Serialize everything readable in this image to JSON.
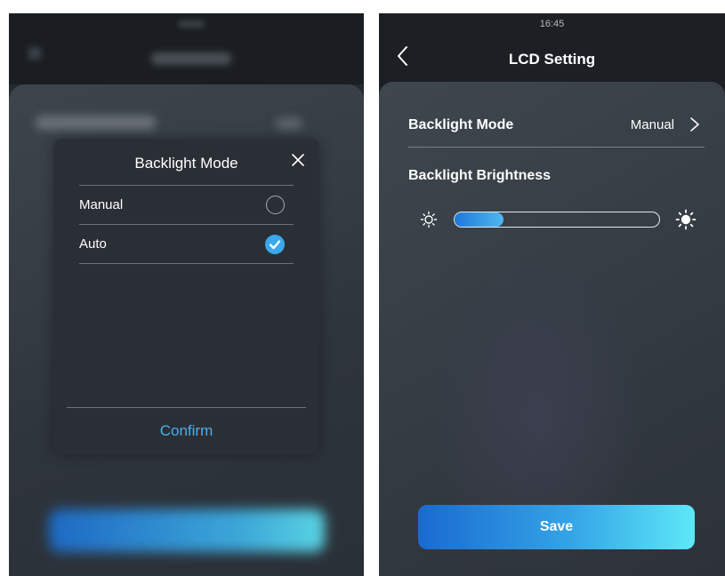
{
  "colors": {
    "accent": "#3aa8ec",
    "confirm_text": "#4ab0ec",
    "dark_background": "#1c2024",
    "modal_background": "#2a2f35",
    "text": "#ffffff"
  },
  "left_screen": {
    "modal": {
      "title": "Backlight Mode",
      "close_icon": "close-icon",
      "options": [
        {
          "label": "Manual",
          "selected": false,
          "icon": "radio-empty-icon"
        },
        {
          "label": "Auto",
          "selected": true,
          "icon": "check-circle-icon"
        }
      ],
      "confirm_label": "Confirm"
    }
  },
  "right_screen": {
    "status_time": "16:45",
    "header": {
      "back_icon": "chevron-left-icon",
      "title": "LCD Setting"
    },
    "backlight_mode": {
      "label": "Backlight Mode",
      "value": "Manual",
      "icon": "chevron-right-icon"
    },
    "backlight_brightness": {
      "label": "Backlight Brightness",
      "level_fraction": 0.24,
      "min_icon": "sun-outline-icon",
      "max_icon": "sun-filled-icon"
    },
    "save_label": "Save"
  }
}
